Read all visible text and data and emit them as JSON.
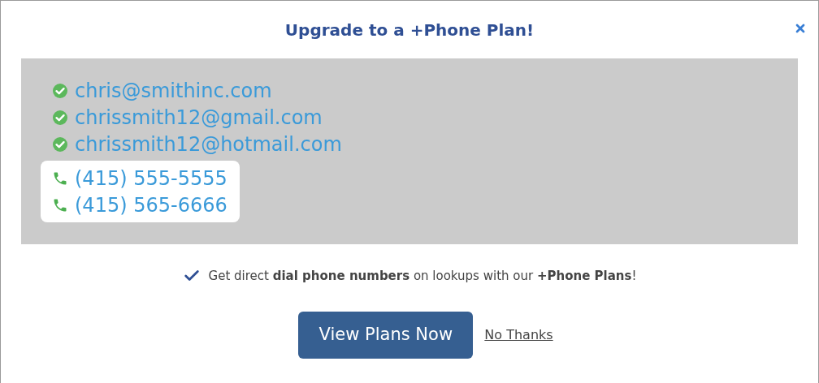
{
  "dialog": {
    "title": "Upgrade to a +Phone Plan!"
  },
  "contacts": [
    {
      "kind": "email",
      "value": "chris@smithinc.com"
    },
    {
      "kind": "email",
      "value": "chrissmith12@gmail.com"
    },
    {
      "kind": "email",
      "value": "chrissmith12@hotmail.com"
    },
    {
      "kind": "phone",
      "value": "(415) 555-5555"
    },
    {
      "kind": "phone",
      "value": "(415) 565-6666"
    }
  ],
  "note": "Get direct **dial phone numbers** on lookups with our **+Phone Plans**!",
  "primary_button": "View Plans Now",
  "secondary_link": "No Thanks"
}
